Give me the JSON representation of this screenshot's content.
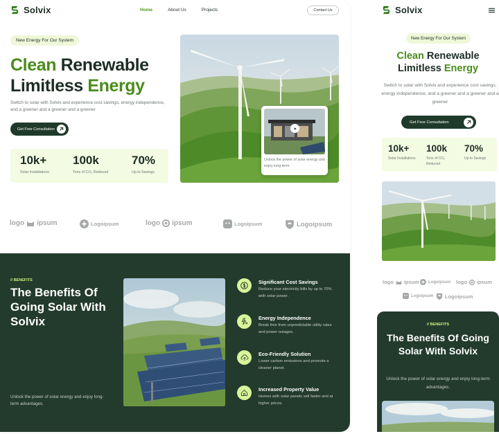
{
  "brand": {
    "name": "Solvix",
    "accent": "#4a8c1c",
    "dark": "#233b2c",
    "light": "#f3fbe3"
  },
  "nav": {
    "links": [
      "Home",
      "About Us",
      "Projects"
    ],
    "contact": "Contact Us",
    "menu_icon": "hamburger-icon"
  },
  "hero": {
    "badge": "New Energy For Our System",
    "title_line1_green": "Clean",
    "title_line1_dark": "Renewable",
    "title_line2_dark": "Limitless",
    "title_line2_green": "Energy",
    "subtitle": "Switch to solar with Solvix and experience cost savings, energy independence, and a greener and a greener and a greener",
    "cta": "Get Free Consultation",
    "card_text": "Unlock the power of solar energy and enjoy long-term",
    "stats": [
      {
        "value": "10k+",
        "label": "Solar Installations"
      },
      {
        "value": "100k",
        "label": "Tons of CO₂ Reduced"
      },
      {
        "value": "70%",
        "label": "Up to Savings"
      }
    ]
  },
  "logos": [
    "logo",
    "ipsum",
    "Logoipsum",
    "logo",
    "ipsum",
    "Logoipsum",
    "Logoipsum"
  ],
  "benefits": {
    "tag": "// BENEFITS",
    "title": "The Benefits Of Going Solar With Solvix",
    "description": "Unlock the power of solar energy and enjoy long-term advantages.",
    "features": [
      {
        "title": "Significant Cost Savings",
        "desc": "Reduce your electricity bills by up to 70% with solar power.",
        "icon": "dollar-icon"
      },
      {
        "title": "Energy Independence",
        "desc": "Break free from unpredictable utility rates and power outages.",
        "icon": "bolt-user-icon"
      },
      {
        "title": "Eco-Friendly Solution",
        "desc": "Lower carbon emissions and promote a cleaner planet.",
        "icon": "cloud-up-icon"
      },
      {
        "title": "Increased Property Value",
        "desc": "Homes with solar panels sell faster and at higher prices.",
        "icon": "home-icon"
      }
    ]
  },
  "mobile": {
    "hero_sub": "Switch to solar with Solvix and experience cost savings, energy independence, and a greener and a greener and a greener",
    "benefits_desc": "Unlock the power of solar energy and enjoy long-term advantages."
  }
}
